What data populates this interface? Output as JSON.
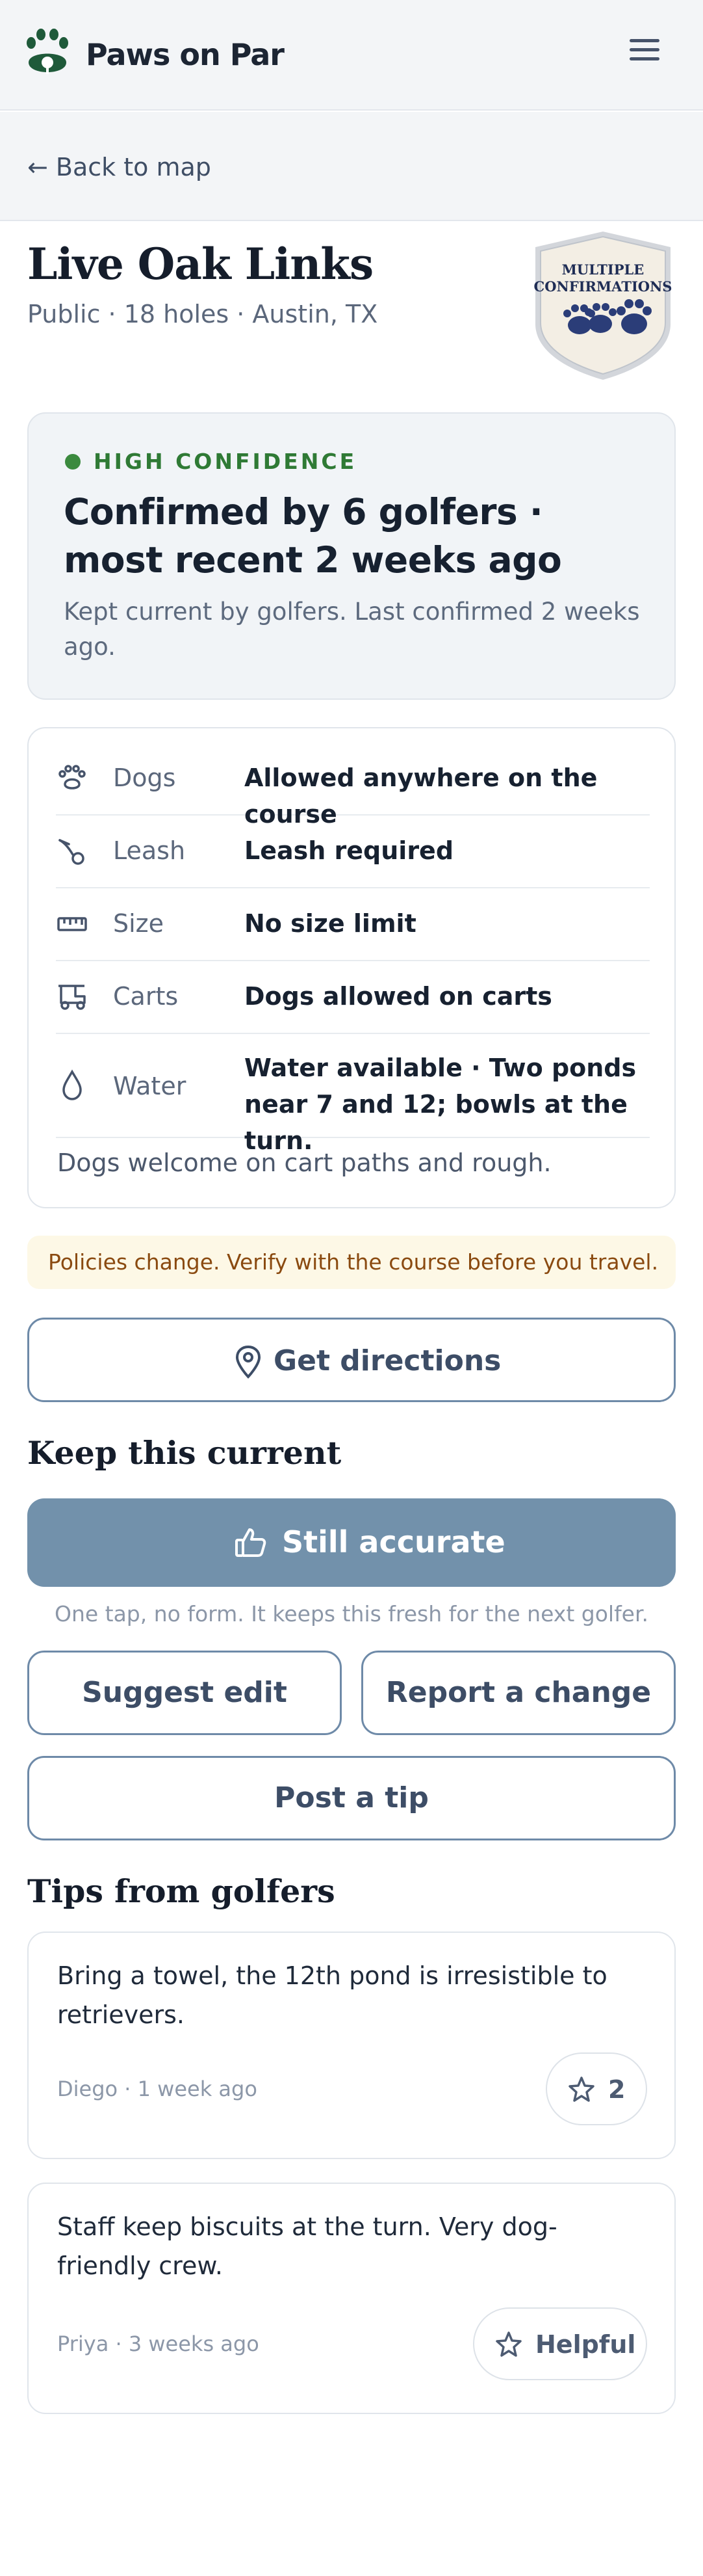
{
  "header": {
    "brand": "Paws on Par",
    "logo_icon": "paw-golf-ball-icon",
    "menu_icon": "hamburger-menu-icon"
  },
  "nav": {
    "back_label": "← Back to map"
  },
  "course": {
    "name": "Live Oak Links",
    "details": "Public · 18 holes · Austin, TX",
    "badge_line1": "MULTIPLE",
    "badge_line2": "CONFIRMATIONS"
  },
  "confidence": {
    "label": "HIGH CONFIDENCE",
    "headline": "Confirmed by 6 golfers · most recent 2 weeks ago",
    "note": "Kept current by golfers. Last confirmed 2 weeks ago.",
    "color": "#3b8a3e"
  },
  "policy": {
    "rows": [
      {
        "icon": "paw-icon",
        "label": "Dogs",
        "value": "Allowed anywhere on the course"
      },
      {
        "icon": "leash-icon",
        "label": "Leash",
        "value": "Leash required"
      },
      {
        "icon": "ruler-icon",
        "label": "Size",
        "value": "No size limit"
      },
      {
        "icon": "golf-cart-icon",
        "label": "Carts",
        "value": "Dogs allowed on carts"
      },
      {
        "icon": "water-drop-icon",
        "label": "Water",
        "value": "Water available · Two ponds near 7 and 12; bowls at the turn."
      }
    ],
    "note": "Dogs welcome on cart paths and rough."
  },
  "warning": {
    "text": "Policies change. Verify with the course before you travel."
  },
  "actions": {
    "directions_label": "Get directions",
    "keep_current_heading": "Keep this current",
    "still_accurate_label": "Still accurate",
    "still_accurate_hint": "One tap, no form. It keeps this fresh for the next golfer.",
    "suggest_edit_label": "Suggest edit",
    "report_change_label": "Report a change",
    "post_tip_label": "Post a tip"
  },
  "tips": {
    "heading": "Tips from golfers",
    "items": [
      {
        "text": "Bring a towel, the 12th pond is irresistible to retrievers.",
        "meta": "Diego · 1 week ago",
        "button": "2"
      },
      {
        "text": "Staff keep biscuits at the turn. Very dog-friendly crew.",
        "meta": "Priya · 3 weeks ago",
        "button": "Helpful"
      }
    ]
  },
  "colors": {
    "brand_green": "#1f5a3a",
    "accent_blue": "#7291ab",
    "warning_bg": "#fdf8e6",
    "warning_text": "#8a4a10"
  }
}
